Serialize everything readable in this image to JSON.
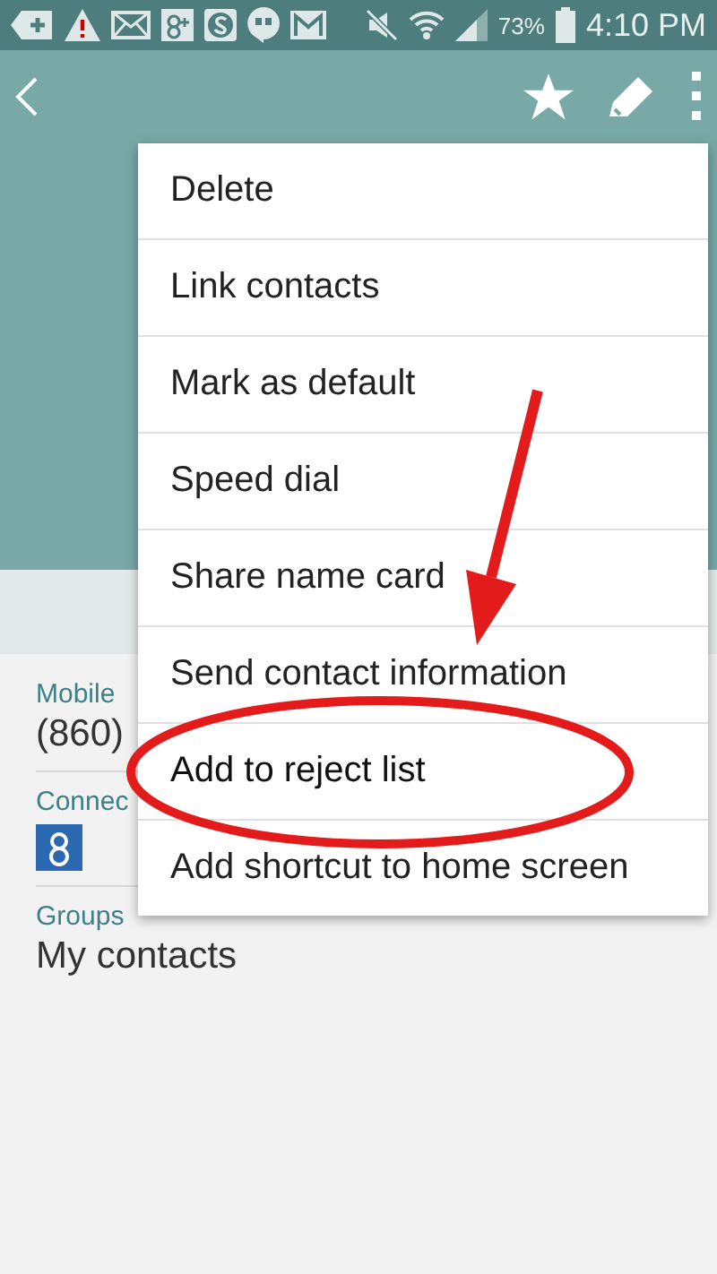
{
  "status_bar": {
    "battery": "73%",
    "time": "4:10 PM"
  },
  "details": [
    {
      "kind": "text",
      "label": "Mobile",
      "value": "(860)"
    },
    {
      "kind": "account",
      "label": "Connec"
    },
    {
      "kind": "text",
      "label": "Groups",
      "value": "My contacts"
    }
  ],
  "menu": {
    "items": [
      {
        "label": "Delete",
        "highlighted": false
      },
      {
        "label": "Link contacts",
        "highlighted": false
      },
      {
        "label": "Mark as default",
        "highlighted": false
      },
      {
        "label": "Speed dial",
        "highlighted": false
      },
      {
        "label": "Share name card",
        "highlighted": false
      },
      {
        "label": "Send contact information",
        "highlighted": false
      },
      {
        "label": "Add to reject list",
        "highlighted": true
      },
      {
        "label": "Add shortcut to home screen",
        "highlighted": false
      }
    ]
  }
}
